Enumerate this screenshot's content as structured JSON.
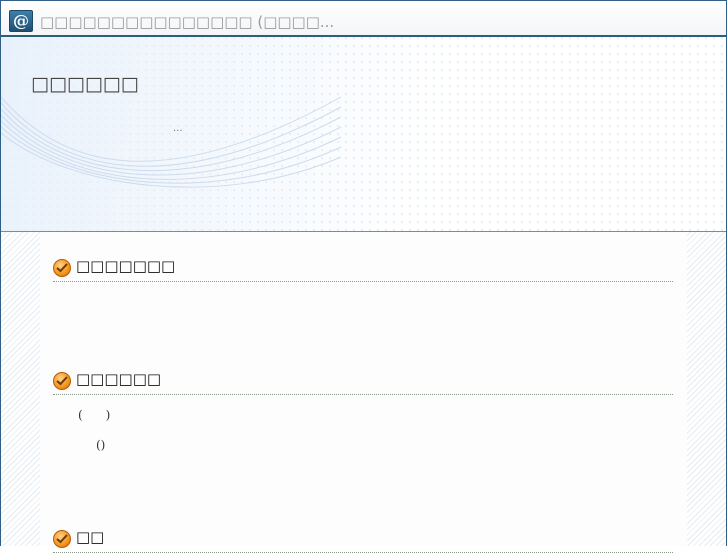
{
  "window": {
    "title": "□□□□□□□□□□□□□□□ (□□□□...",
    "icon": "at-sign-icon"
  },
  "banner": {
    "heading": "□□□□□□",
    "subtext": "..."
  },
  "sections": [
    {
      "label": "□□□□□□□",
      "icon": "check-icon"
    },
    {
      "label": "□□□□□□",
      "icon": "check-icon",
      "lines": [
        "(      )",
        "()"
      ]
    },
    {
      "label": "□□",
      "icon": "check-icon"
    }
  ],
  "colors": {
    "title_border": "#2c5f7a",
    "check_orange": "#f2941c",
    "dotted_rule": "#8a9a8a"
  }
}
